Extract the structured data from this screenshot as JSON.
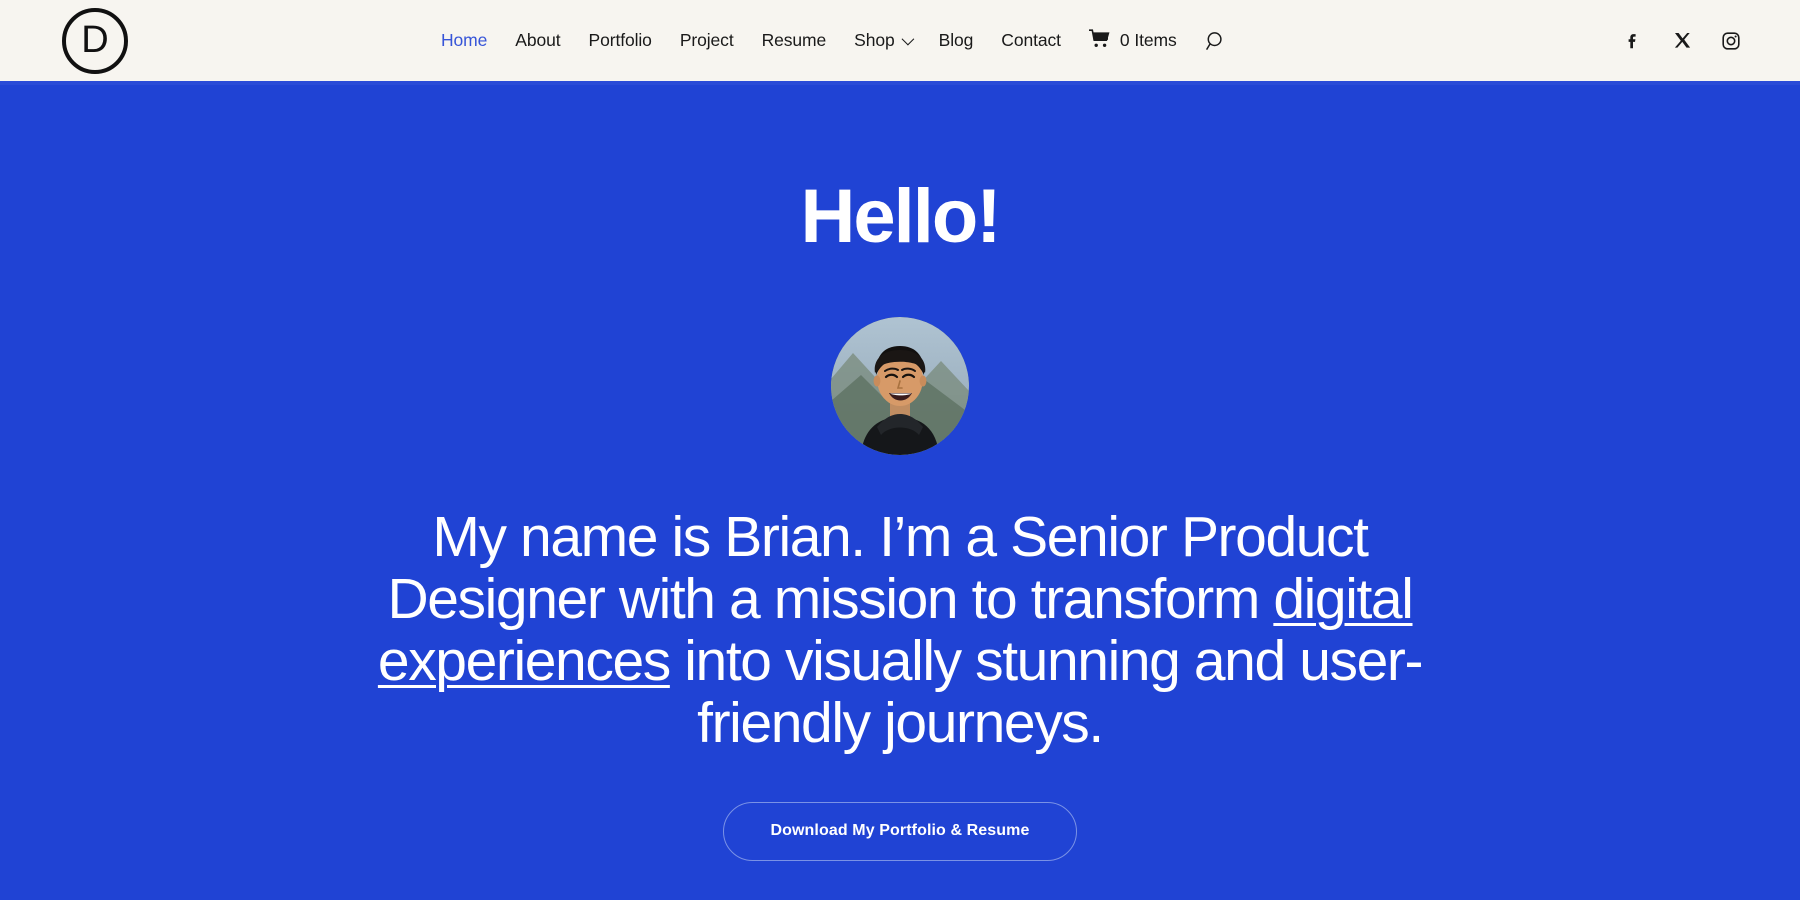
{
  "header": {
    "logo": {
      "letter": "D",
      "icon": "circled-d-logo"
    },
    "background_color": "#F7F5F0",
    "nav_items": [
      {
        "label": "Home",
        "active": true,
        "has_dropdown": false
      },
      {
        "label": "About",
        "active": false,
        "has_dropdown": false
      },
      {
        "label": "Portfolio",
        "active": false,
        "has_dropdown": false
      },
      {
        "label": "Project",
        "active": false,
        "has_dropdown": false
      },
      {
        "label": "Resume",
        "active": false,
        "has_dropdown": false
      },
      {
        "label": "Shop",
        "active": false,
        "has_dropdown": true
      },
      {
        "label": "Blog",
        "active": false,
        "has_dropdown": false
      },
      {
        "label": "Contact",
        "active": false,
        "has_dropdown": false
      }
    ],
    "cart": {
      "icon": "shopping-cart-icon",
      "label": "0 Items",
      "count": 0
    },
    "search": {
      "icon": "search-icon"
    },
    "socials": [
      {
        "name": "facebook-icon",
        "label": "f"
      },
      {
        "name": "x-twitter-icon",
        "label": "X"
      },
      {
        "name": "instagram-icon",
        "label": "Instagram"
      }
    ],
    "active_link_color": "#3755D8",
    "text_color": "#1A1A1A"
  },
  "hero": {
    "background_color": "#2043D4",
    "title": "Hello!",
    "avatar": {
      "alt": "Portrait of Brian smiling in front of mountains"
    },
    "subtitle_parts": [
      {
        "text": "My name is Brian. I’m a Senior Product Designer with a mission to transform ",
        "underline": false
      },
      {
        "text": "digital experiences",
        "underline": true
      },
      {
        "text": " into visually stunning and user-friendly journeys.",
        "underline": false
      }
    ],
    "cta_label": "Download My Portfolio & Resume",
    "cta_border_color": "#7A92E6",
    "text_color": "#FFFFFF"
  }
}
